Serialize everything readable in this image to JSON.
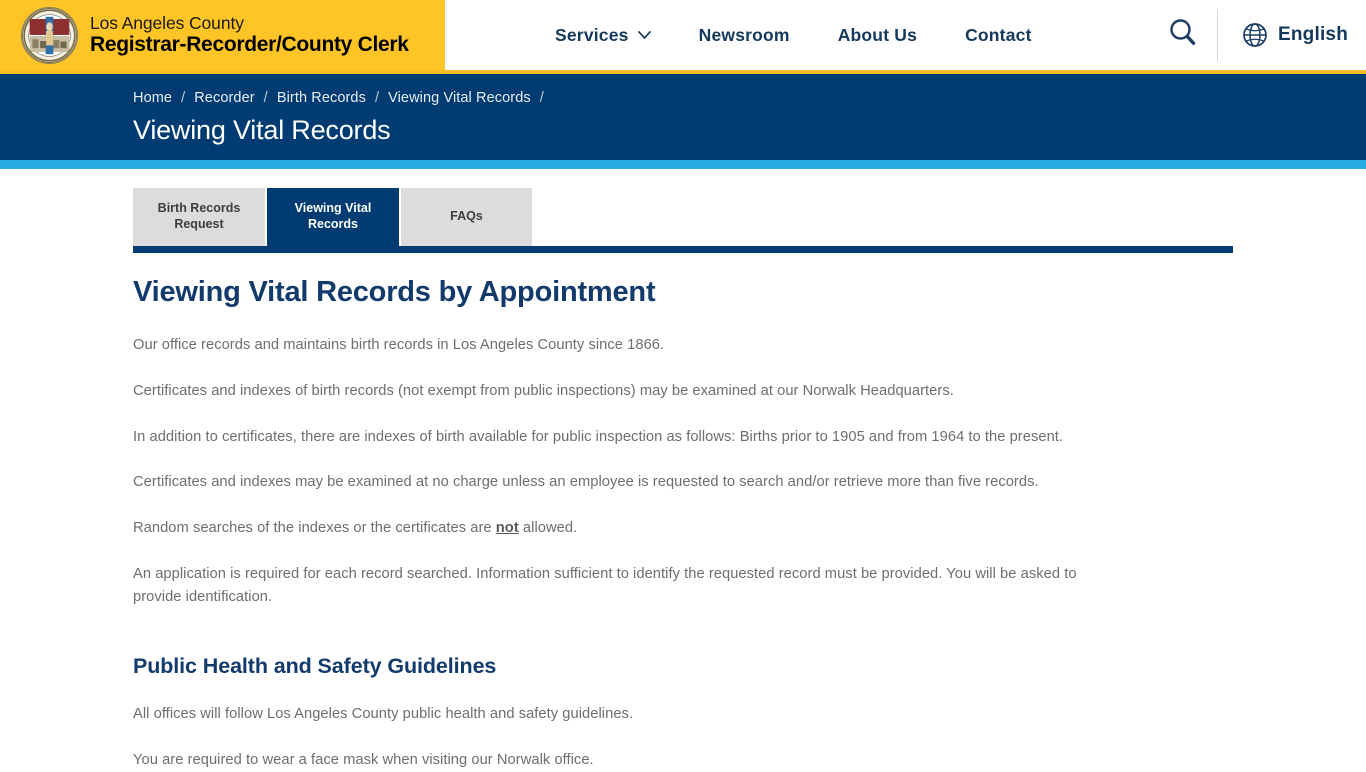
{
  "header": {
    "brand": {
      "line1": "Los Angeles County",
      "line2": "Registrar-Recorder/County Clerk",
      "seal_icon": "county-seal"
    },
    "nav_items": [
      {
        "label": "Services",
        "has_dropdown": true,
        "icon": "chevron-down-icon"
      },
      {
        "label": "Newsroom",
        "has_dropdown": false
      },
      {
        "label": "About Us",
        "has_dropdown": false
      },
      {
        "label": "Contact",
        "has_dropdown": false
      }
    ],
    "search_icon": "search-icon",
    "language": {
      "icon": "globe-icon",
      "label": "English"
    },
    "colors": {
      "brand_yellow": "#ffc425",
      "accent_underline": "#f6bf26"
    }
  },
  "banner": {
    "breadcrumb": [
      "Home",
      "Recorder",
      "Birth Records",
      "Viewing Vital Records",
      ""
    ],
    "separator": "/",
    "title": "Viewing Vital Records",
    "bg_color": "#003b71",
    "accent_bar_color": "#27a9e1"
  },
  "tabs": [
    {
      "label": "Birth Records Request",
      "line1": "Birth Records",
      "line2": "Request",
      "active": false
    },
    {
      "label": "Viewing Vital Records",
      "line1": "Viewing Vital",
      "line2": "Records",
      "active": true
    },
    {
      "label": "FAQs",
      "line1": "FAQs",
      "line2": "",
      "active": false
    }
  ],
  "main": {
    "heading": "Viewing Vital Records by Appointment",
    "paragraphs": [
      "Our office records and maintains birth records in Los Angeles County since 1866.",
      "Certificates and indexes of birth records (not exempt from public inspections) may be examined at our Norwalk Headquarters.",
      "In addition to certificates, there are indexes of birth available for public inspection as follows: Births prior to 1905 and from 1964 to the present.",
      "Certificates and indexes may be examined at no charge unless an employee is requested to search and/or retrieve more than five records."
    ],
    "random_search": {
      "before": "Random searches of the indexes or the certificates are ",
      "emphasis": "not",
      "after": " allowed."
    },
    "application_paragraph": "An application is required for each record searched. Information sufficient to identify the requested record must be provided. You will be asked to provide identification.",
    "section2": {
      "heading": "Public Health and Safety Guidelines",
      "paragraphs": [
        "All offices will follow Los Angeles County public health and safety guidelines.",
        "You are required to wear a face mask when visiting our Norwalk office."
      ]
    }
  }
}
